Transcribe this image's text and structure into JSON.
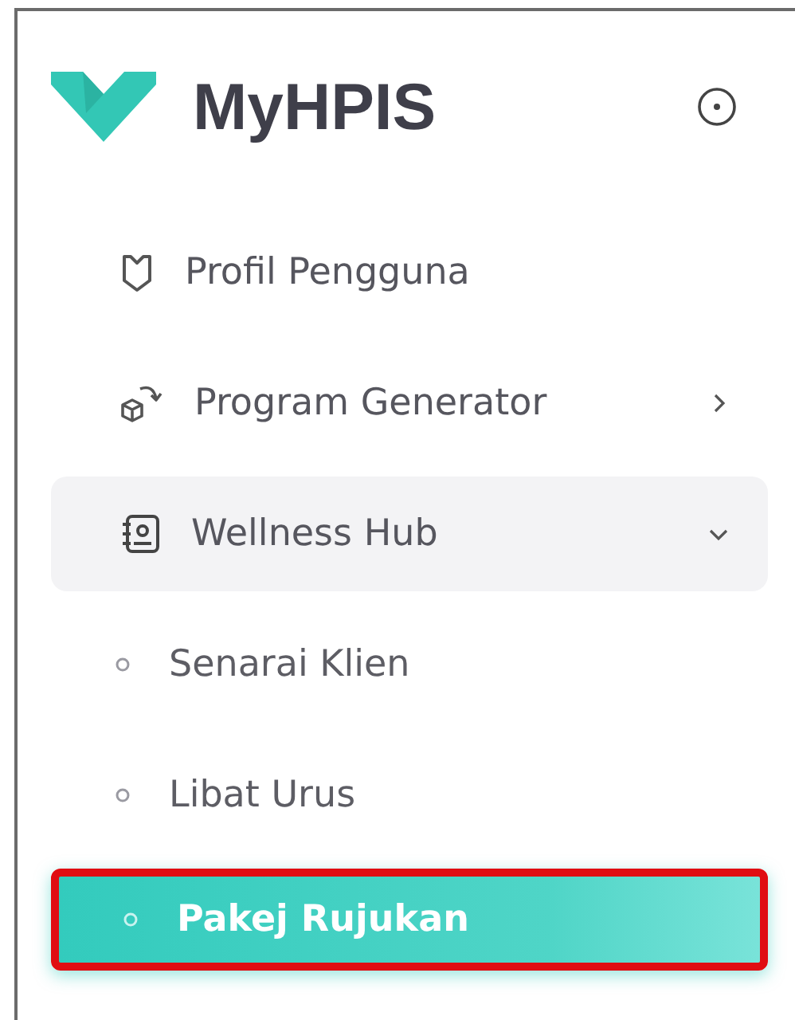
{
  "brand": {
    "title": "MyHPIS"
  },
  "menu": [
    {
      "kind": "link",
      "label": "Profil Pengguna"
    },
    {
      "kind": "submenu",
      "label": "Program Generator",
      "expanded": false
    },
    {
      "kind": "submenu",
      "label": "Wellness Hub",
      "expanded": true,
      "children": [
        {
          "label": "Senarai Klien",
          "selected": false
        },
        {
          "label": "Libat Urus",
          "selected": false
        },
        {
          "label": "Pakej Rujukan",
          "selected": true
        }
      ]
    }
  ]
}
